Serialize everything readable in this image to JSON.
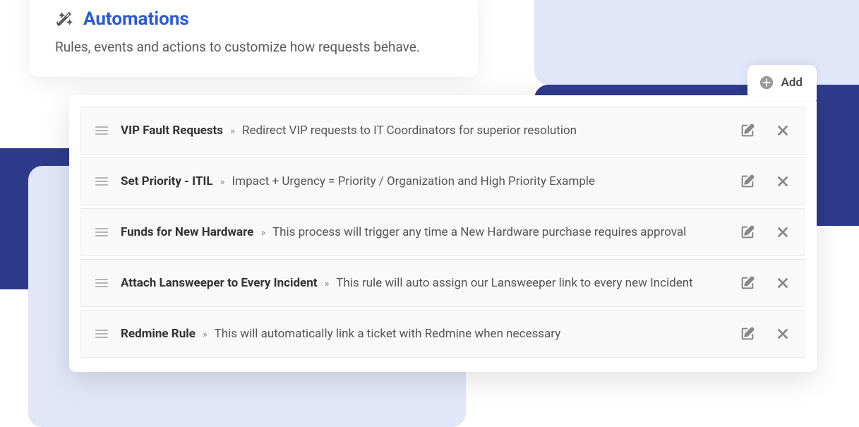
{
  "header": {
    "title": "Automations",
    "subtitle": "Rules, events and actions to customize how requests behave."
  },
  "add_button": {
    "label": "Add"
  },
  "rules": [
    {
      "name": "VIP Fault Requests",
      "description": "Redirect VIP requests to IT Coordinators for superior resolution"
    },
    {
      "name": "Set Priority - ITIL",
      "description": "Impact + Urgency = Priority / Organization and High Priority Example"
    },
    {
      "name": "Funds for New Hardware",
      "description": "This process will trigger any time a New Hardware purchase requires approval"
    },
    {
      "name": "Attach Lansweeper to Every Incident",
      "description": "This rule will auto assign our Lansweeper link to every new Incident"
    },
    {
      "name": "Redmine Rule",
      "description": "This will automatically link a ticket with Redmine when necessary"
    }
  ],
  "separator": "»"
}
